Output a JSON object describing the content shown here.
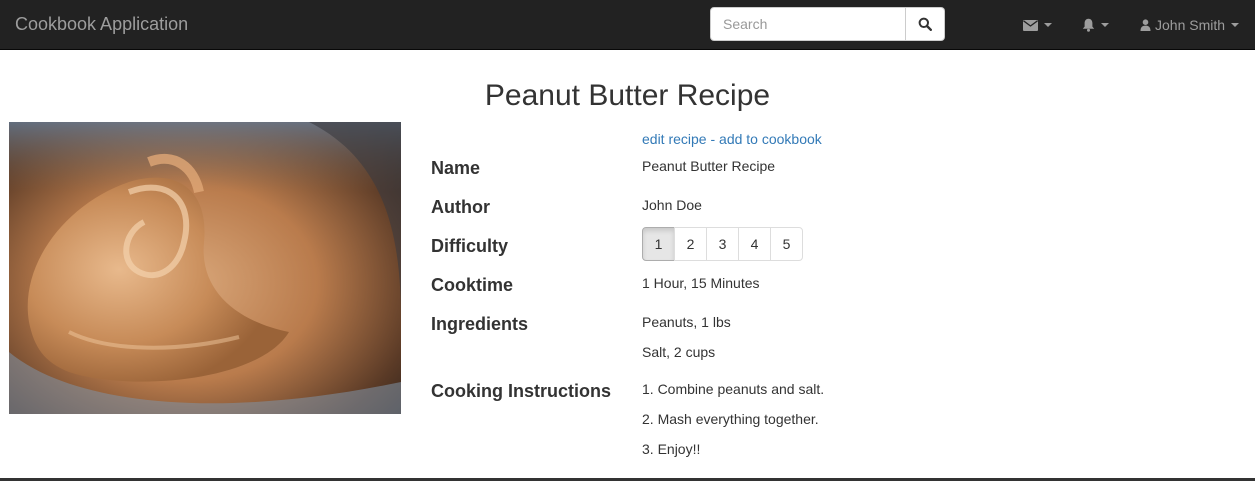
{
  "navbar": {
    "brand": "Cookbook Application",
    "search_placeholder": "Search",
    "icons": {
      "search": "search-icon",
      "mail": "envelope-icon",
      "notifications": "bell-icon",
      "user": "user-icon"
    },
    "user_name": "John Smith"
  },
  "recipe": {
    "title": "Peanut Butter Recipe",
    "image": "peanut-butter-jar-photo",
    "actions": {
      "edit": "edit recipe",
      "separator": " - ",
      "add": "add to cookbook"
    },
    "labels": {
      "name": "Name",
      "author": "Author",
      "difficulty": "Difficulty",
      "cooktime": "Cooktime",
      "ingredients": "Ingredients",
      "instructions": "Cooking Instructions"
    },
    "name": "Peanut Butter Recipe",
    "author": "John Doe",
    "difficulty": {
      "options": [
        "1",
        "2",
        "3",
        "4",
        "5"
      ],
      "selected": "1"
    },
    "cooktime": "1 Hour, 15 Minutes",
    "ingredients": [
      "Peanuts, 1 lbs",
      "Salt, 2 cups"
    ],
    "instructions": [
      "1. Combine peanuts and salt.",
      "2. Mash everything together.",
      "3. Enjoy!!"
    ]
  },
  "colors": {
    "navbar_bg": "#222222",
    "navbar_text": "#9d9d9d",
    "link": "#337ab7",
    "text": "#333333"
  }
}
